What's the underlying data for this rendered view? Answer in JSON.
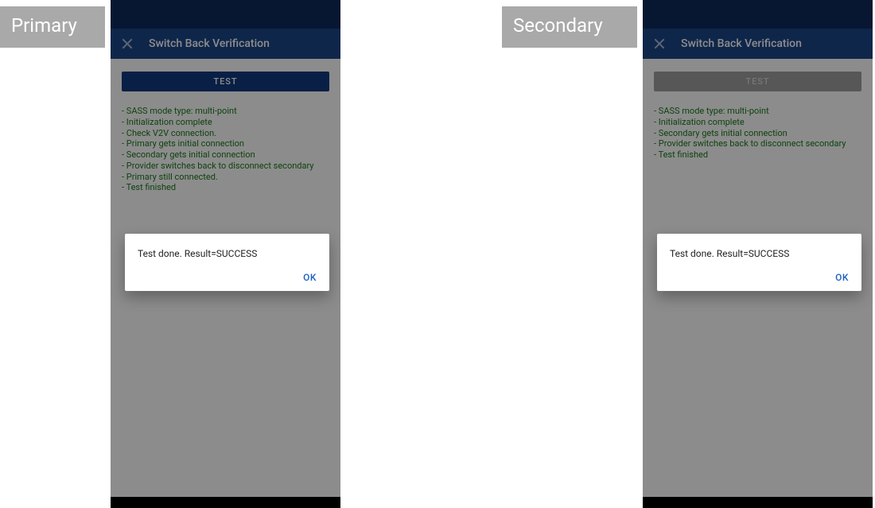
{
  "labels": {
    "primary": "Primary",
    "secondary": "Secondary"
  },
  "left": {
    "title": "Switch Back Verification",
    "test_button": "TEST",
    "test_button_disabled": false,
    "log": [
      "SASS mode type: multi-point",
      "Initialization complete",
      "Check V2V connection.",
      "Primary gets initial connection",
      "Secondary gets initial connection",
      "Provider switches back to disconnect secondary",
      "Primary still connected.",
      "Test finished"
    ],
    "dialog": {
      "message": "Test done. Result=SUCCESS",
      "ok": "OK"
    }
  },
  "right": {
    "title": "Switch Back Verification",
    "test_button": "TEST",
    "test_button_disabled": true,
    "log": [
      "SASS mode type: multi-point",
      "Initialization complete",
      "Secondary gets initial connection",
      "Provider switches back to disconnect secondary",
      "Test finished"
    ],
    "dialog": {
      "message": "Test done. Result=SUCCESS",
      "ok": "OK"
    }
  }
}
